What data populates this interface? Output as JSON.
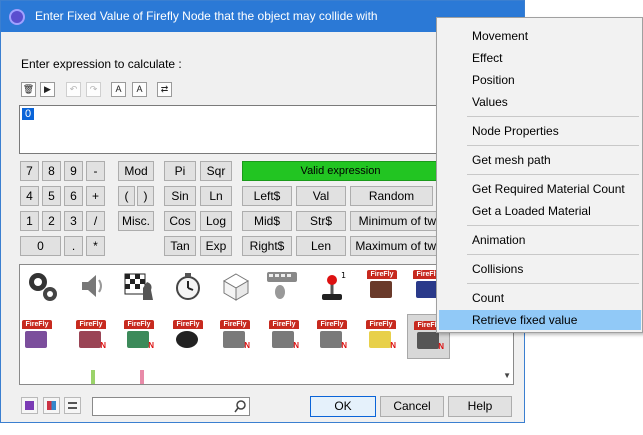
{
  "dialog": {
    "title": "Enter Fixed Value of Firefly Node that the object may collide with",
    "prompt": "Enter expression to calculate :",
    "expression_value": "0",
    "status": "Valid expression",
    "status_color": "#22c522",
    "title_color": "#2b79d6",
    "keypad": {
      "row1": [
        "7",
        "8",
        "9",
        "-"
      ],
      "row2": [
        "4",
        "5",
        "6",
        "+"
      ],
      "row3": [
        "1",
        "2",
        "3",
        "/"
      ],
      "row4": [
        "0",
        ".",
        "*"
      ]
    },
    "func_buttons": {
      "mod": "Mod",
      "paren_open": "(",
      "paren_close": ")",
      "misc": "Misc.",
      "pi": "Pi",
      "sqr": "Sqr",
      "sin": "Sin",
      "ln": "Ln",
      "cos": "Cos",
      "log": "Log",
      "tan": "Tan",
      "exp": "Exp",
      "left": "Left$",
      "val": "Val",
      "random": "Random",
      "mid": "Mid$",
      "str": "Str$",
      "min": "Minimum of tw",
      "right": "Right$",
      "len": "Len",
      "max": "Maximum of tw"
    },
    "icon_labels": {
      "firefly": "FireFly"
    },
    "footer": {
      "ok": "OK",
      "cancel": "Cancel",
      "help": "Help"
    }
  },
  "context_menu": {
    "highlight_color": "#91c9f7",
    "items": [
      "Movement",
      "Effect",
      "Position",
      "Values",
      "Node Properties",
      "Get mesh path",
      "Get Required Material Count",
      "Get a Loaded Material",
      "Animation",
      "Collisions",
      "Count",
      "Retrieve fixed value"
    ]
  }
}
